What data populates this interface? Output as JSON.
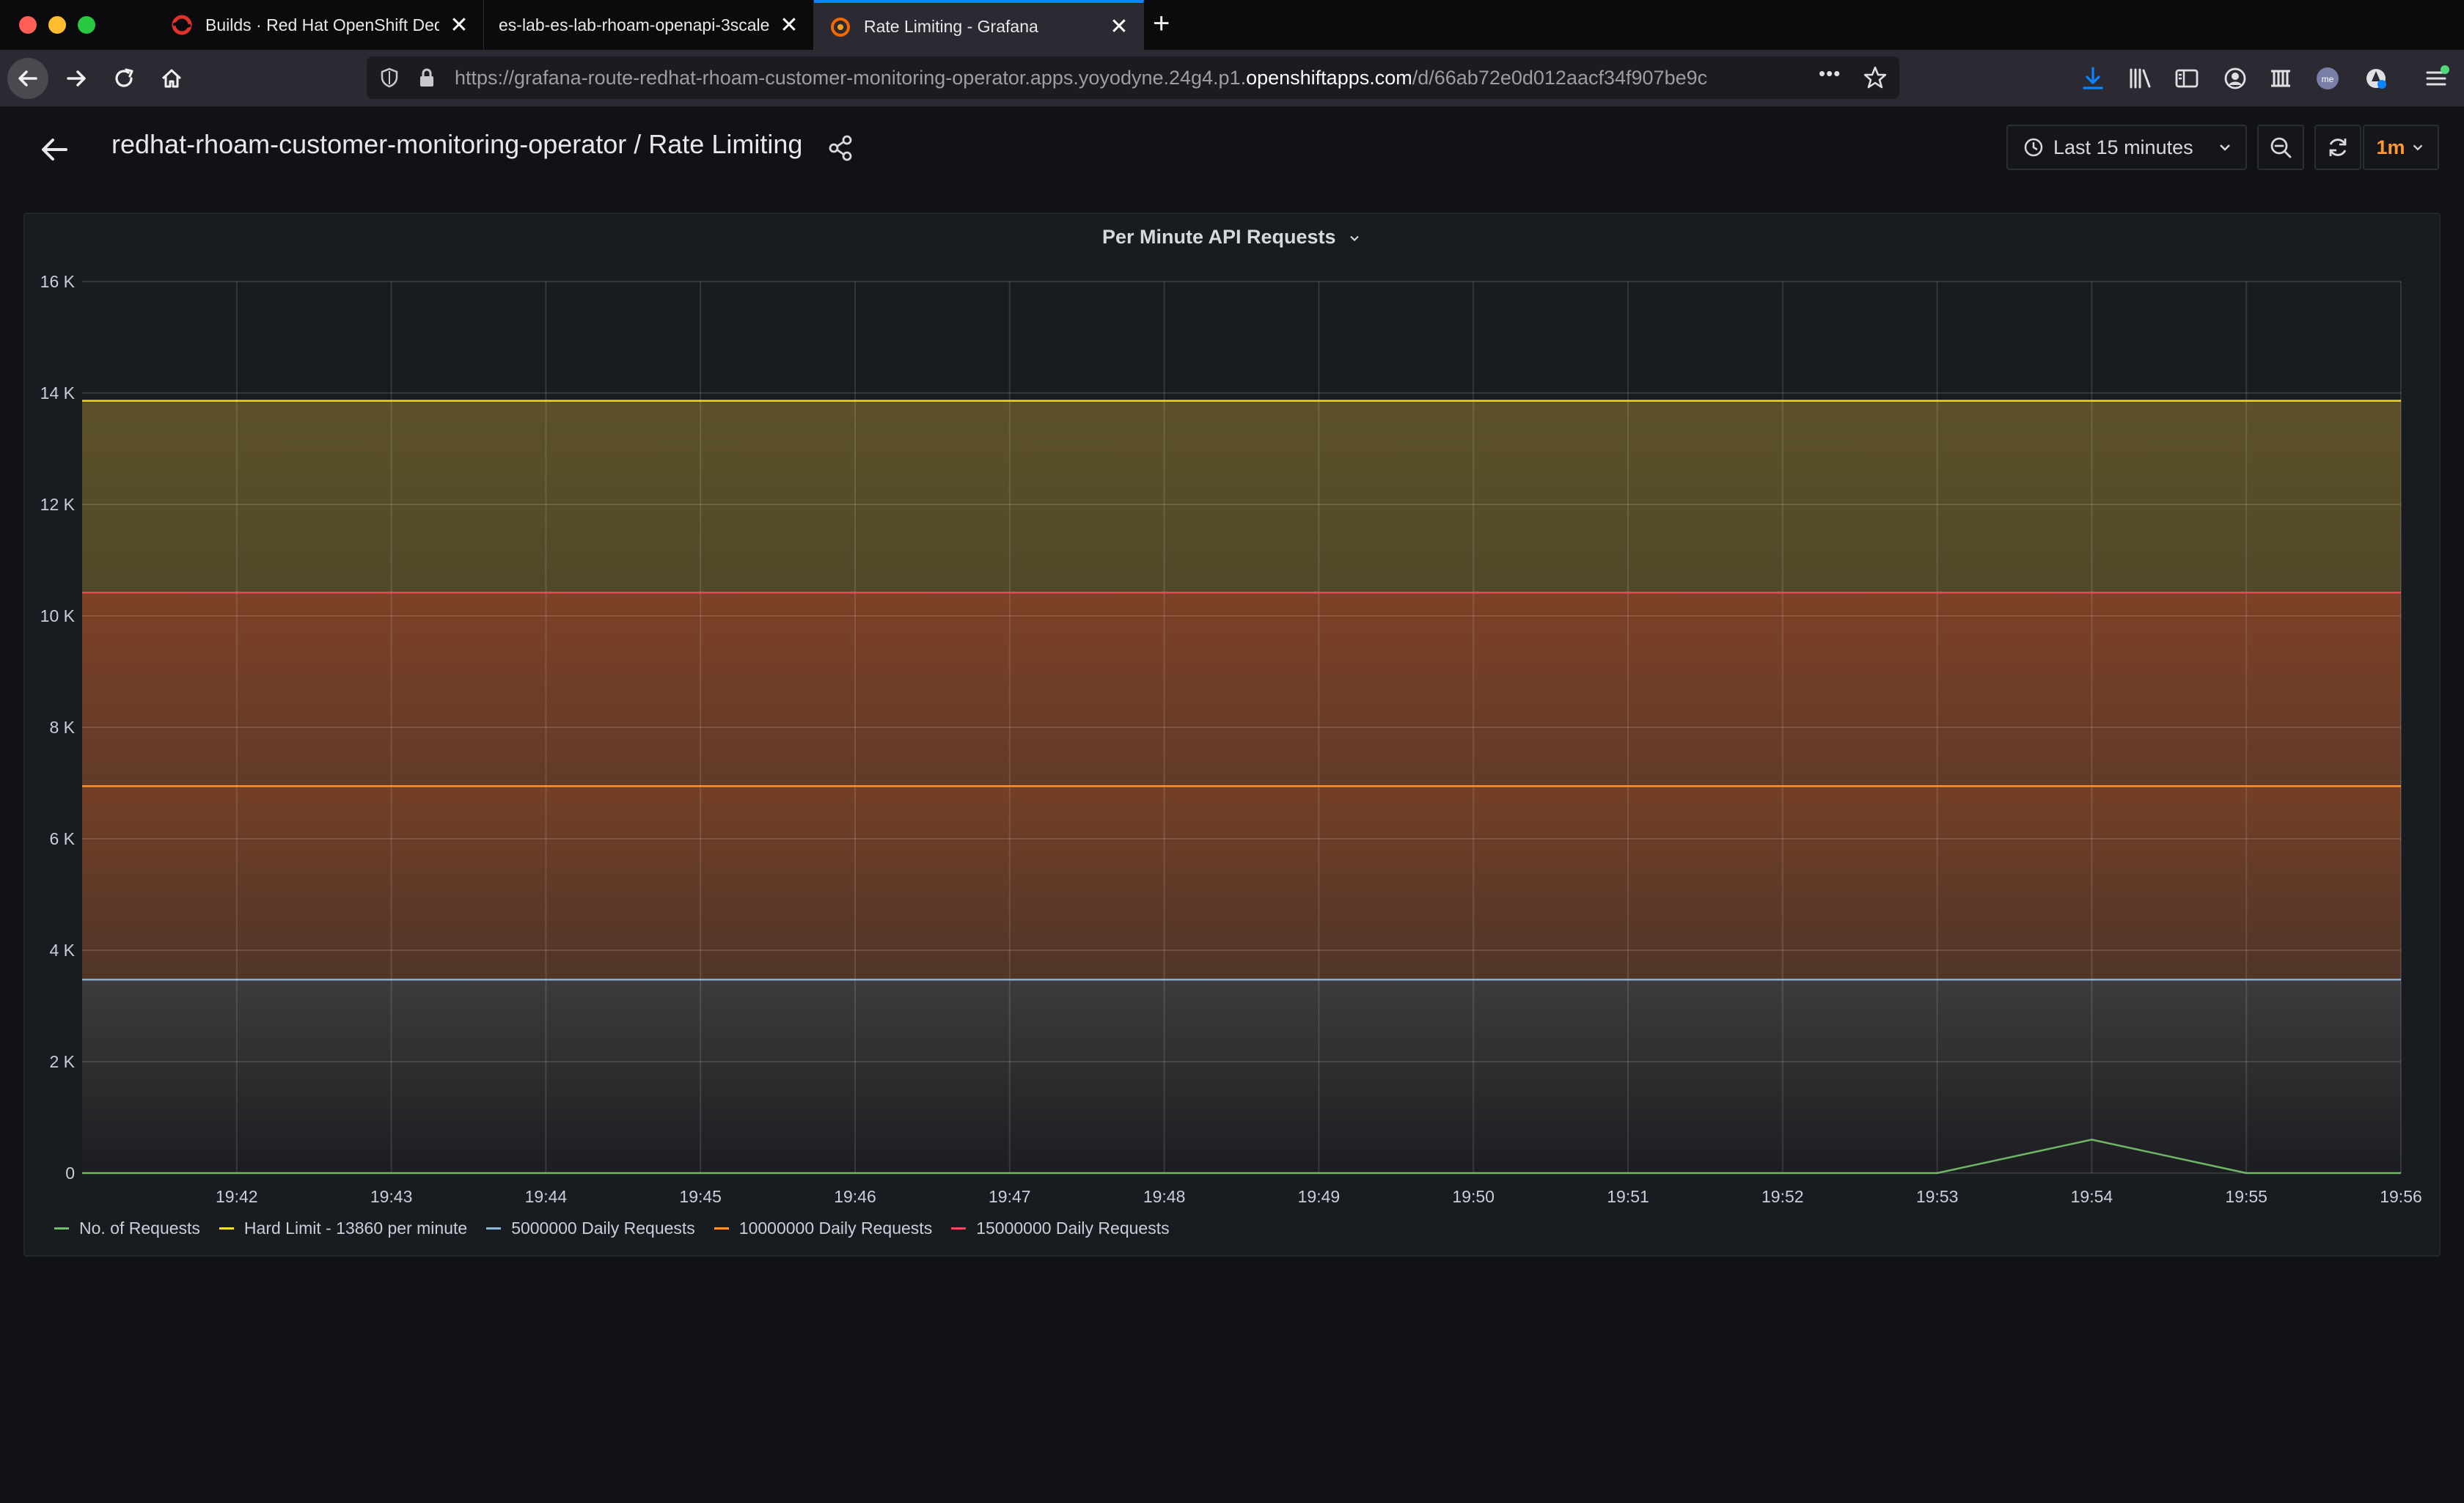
{
  "browser": {
    "tabs": [
      {
        "label": "Builds · Red Hat OpenShift Dedicated",
        "icon": "openshift-icon",
        "active": false
      },
      {
        "label": "es-lab-es-lab-rhoam-openapi-3scale",
        "icon": "",
        "active": false
      },
      {
        "label": "Rate Limiting - Grafana",
        "icon": "grafana-icon",
        "active": true
      }
    ],
    "url_prefix": "https://grafana-route-redhat-rhoam-customer-monitoring-operator.apps.yoyodyne.24g4.p1.",
    "url_domain": "openshiftapps.com",
    "url_suffix": "/d/66ab72e0d012aacf34f907be9c",
    "more_label": "•••"
  },
  "dashboard": {
    "title": "redhat-rhoam-customer-monitoring-operator / Rate Limiting",
    "time_range": "Last 15 minutes",
    "refresh_interval": "1m"
  },
  "panel": {
    "title": "Per Minute API Requests"
  },
  "colors": {
    "accent_orange": "#ff9830",
    "blue_tab": "#0a84ff",
    "requests": "#73bf69",
    "hard_limit": "#fade2a",
    "daily_5m": "#8ab8d8",
    "daily_10m": "#ff9830",
    "daily_15m": "#f2495c"
  },
  "chart_data": {
    "type": "line",
    "title": "Per Minute API Requests",
    "x": [
      "19:41",
      "19:42",
      "19:43",
      "19:44",
      "19:45",
      "19:46",
      "19:47",
      "19:48",
      "19:49",
      "19:50",
      "19:51",
      "19:52",
      "19:53",
      "19:54",
      "19:55",
      "19:56"
    ],
    "x_ticks": [
      "19:42",
      "19:43",
      "19:44",
      "19:45",
      "19:46",
      "19:47",
      "19:48",
      "19:49",
      "19:50",
      "19:51",
      "19:52",
      "19:53",
      "19:54",
      "19:55",
      "19:56"
    ],
    "y_ticks": [
      "0",
      "2 K",
      "4 K",
      "6 K",
      "8 K",
      "10 K",
      "12 K",
      "14 K",
      "16 K"
    ],
    "ylim": [
      0,
      16000
    ],
    "grid": true,
    "legend_position": "bottom-left",
    "series": [
      {
        "name": "No. of Requests",
        "color": "#73bf69",
        "values": [
          0,
          0,
          0,
          0,
          0,
          0,
          0,
          0,
          0,
          0,
          0,
          0,
          0,
          600,
          0,
          0
        ]
      },
      {
        "name": "Hard Limit - 13860 per minute",
        "color": "#fade2a",
        "values": [
          13860,
          13860,
          13860,
          13860,
          13860,
          13860,
          13860,
          13860,
          13860,
          13860,
          13860,
          13860,
          13860,
          13860,
          13860,
          13860
        ]
      },
      {
        "name": "5000000 Daily Requests",
        "color": "#8ab8d8",
        "values": [
          3472,
          3472,
          3472,
          3472,
          3472,
          3472,
          3472,
          3472,
          3472,
          3472,
          3472,
          3472,
          3472,
          3472,
          3472,
          3472
        ]
      },
      {
        "name": "10000000 Daily Requests",
        "color": "#ff9830",
        "values": [
          6944,
          6944,
          6944,
          6944,
          6944,
          6944,
          6944,
          6944,
          6944,
          6944,
          6944,
          6944,
          6944,
          6944,
          6944,
          6944
        ]
      },
      {
        "name": "15000000 Daily Requests",
        "color": "#f2495c",
        "values": [
          10417,
          10417,
          10417,
          10417,
          10417,
          10417,
          10417,
          10417,
          10417,
          10417,
          10417,
          10417,
          10417,
          10417,
          10417,
          10417
        ]
      }
    ]
  }
}
